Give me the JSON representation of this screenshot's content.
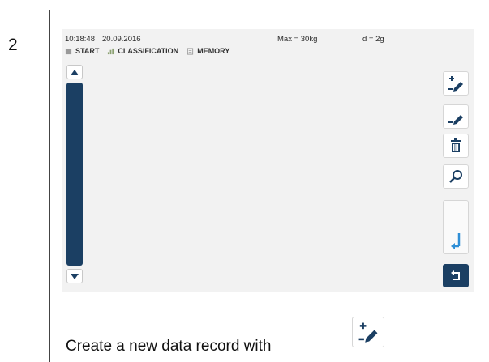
{
  "step": {
    "number": "2"
  },
  "status_bar": {
    "time": "10:18:48",
    "date": "20.09.2016",
    "max": "Max = 30kg",
    "d": "d = 2g"
  },
  "nav": {
    "items": [
      {
        "label": "START",
        "icon": "home-icon"
      },
      {
        "label": "CLASSIFICATION",
        "icon": "classification-icon"
      },
      {
        "label": "MEMORY",
        "icon": "memory-icon"
      }
    ]
  },
  "side_buttons": [
    {
      "name": "new-record",
      "icon": "add-record-icon"
    },
    {
      "name": "edit-record",
      "icon": "edit-pencil-icon"
    },
    {
      "name": "delete-record",
      "icon": "trash-icon"
    },
    {
      "name": "search",
      "icon": "search-icon"
    },
    {
      "name": "enter",
      "icon": "enter-arrow-icon"
    },
    {
      "name": "back",
      "icon": "back-arrow-icon"
    }
  ],
  "instruction": {
    "text": "Create a new data record with"
  },
  "colors": {
    "accent_dark": "#1b3f63",
    "accent_light": "#2f8fd6",
    "screen_bg": "#f2f2f2"
  }
}
